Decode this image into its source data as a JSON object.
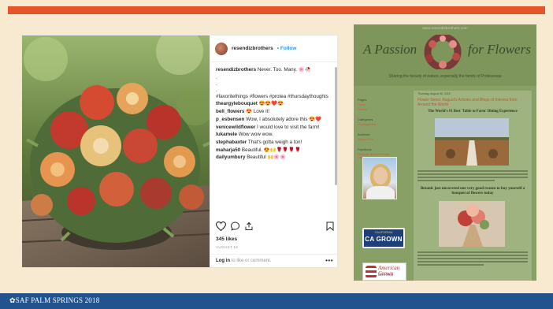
{
  "footer": {
    "text": "SAF PALM SPRINGS 2018"
  },
  "instagram": {
    "username": "resendizbrothers",
    "follow_label": "• Follow",
    "caption_user": "resendizbrothers",
    "caption_text": "Never. Too. Many. 🌸🥀",
    "hashtags": "#favoritethings #flowers #protea #thursdaythoughts",
    "comments": [
      {
        "user": "theargylebouquet",
        "text": "😍😍❤️😍"
      },
      {
        "user": "bell_flowers",
        "text": "😍 Love it!"
      },
      {
        "user": "p_esbensen",
        "text": "Wow, I absolutely adore this 😍❤️"
      },
      {
        "user": "venicewildflower",
        "text": "I would love to visit the farm!"
      },
      {
        "user": "lukamele",
        "text": "Wow wow wow."
      },
      {
        "user": "stephabaxter",
        "text": "That's gotta weigh a ton!"
      },
      {
        "user": "maharja50",
        "text": "Beautiful. 😍🙌🌹🌹🌹🌹"
      },
      {
        "user": "dailyumbury",
        "text": "Beautiful 🙌🌸🌸"
      }
    ],
    "likes": "345 likes",
    "date": "AUGUST 16",
    "login_link": "Log in",
    "login_rest": "to like or comment.",
    "more": "•••",
    "icons": [
      "heart-icon",
      "comment-icon",
      "share-icon",
      "bookmark-icon"
    ]
  },
  "blog": {
    "url": "www.resendizbrothers.com",
    "title_left": "A Passion",
    "title_right": "for Flowers",
    "tagline": "Sharing the beauty of nature, especially the family of Proteaceae",
    "sidebar": [
      {
        "heading": "Pages",
        "links": [
          "Home",
          "Contact"
        ]
      },
      {
        "heading": "Categories",
        "links": [
          "Uncategorized"
        ]
      },
      {
        "heading": "Archives",
        "links": [
          "August 2018"
        ]
      },
      {
        "heading": "Facebook",
        "links": [
          "Resendiz Brothers Protea Growers"
        ]
      }
    ],
    "badge_ca_top": "CALIFORNIA",
    "badge_ca_main": "CA GROWN",
    "badge_ag_main": "American Grown",
    "badge_ag_sub": "CERTIFIED",
    "post_date": "Thursday, August 30, 2018",
    "post_heading": "Flower News: August's Articles and Blogs of Interest from Around the World",
    "post_sub1": "The World's #1 Best 'Table to Farm' Dining Experience",
    "post_sub2": "Botanic just uncovered one very good reason to buy yourself a bouquet of flowers today"
  },
  "colors": {
    "accent_orange": "#e8542a",
    "footer_blue": "#23538f",
    "ig_link": "#3897f0",
    "blog_green": "#7e955c"
  }
}
